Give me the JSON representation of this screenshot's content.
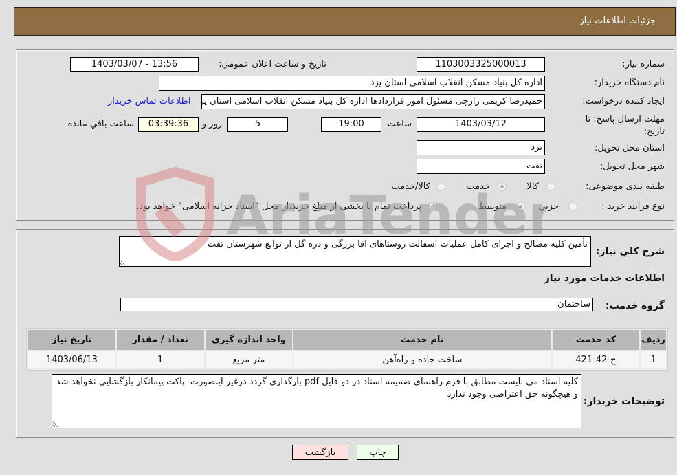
{
  "header": {
    "title": "جزئیات اطلاعات نیاز"
  },
  "details": {
    "need_number_label": "شماره نیاز:",
    "need_number": "1103003325000013",
    "announce_label": "تاریخ و ساعت اعلان عمومي:",
    "announce_value": "1403/03/07 - 13:56",
    "buyer_org_label": "نام دستگاه خریدار:",
    "buyer_org": "اداره کل بنیاد مسکن انقلاب اسلامی استان یزد",
    "requester_label": "ایجاد کننده درخواست:",
    "requester": "حمیدرضا کریمی زارچی مسئول امور قراردادها اداره کل بنیاد مسکن انقلاب اسلامی استان یزد",
    "buyer_contact_link": "اطلاعات تماس خریدار",
    "deadline_label": "مهلت ارسال پاسخ: تا تاریخ:",
    "deadline_date": "1403/03/12",
    "time_label": "ساعت",
    "deadline_time": "19:00",
    "days_value": "5",
    "days_label": "روز و",
    "remaining_time": "03:39:36",
    "remaining_label": "ساعت باقي مانده",
    "province_label": "استان محل تحویل:",
    "province": "یزد",
    "city_label": "شهر محل تحویل:",
    "city": "تفت",
    "category_label": "طبقه بندی موضوعی:",
    "category_options": [
      {
        "label": "کالا",
        "selected": false
      },
      {
        "label": "خدمت",
        "selected": true
      },
      {
        "label": "کالا/خدمت",
        "selected": false
      }
    ],
    "process_label": "نوع فرآیند خرید :",
    "process_options": [
      {
        "label": "جزيي",
        "selected": false
      },
      {
        "label": "متوسط",
        "selected": true
      }
    ],
    "treasury_checkbox_label": "پرداخت تمام یا بخشی از مبلغ خرید،از محل \"اسناد خزانه اسلامی\" خواهد بود.",
    "treasury_checked": true
  },
  "description": {
    "label": "شرح کلي نیاز:",
    "value": "تأمین کلیه مصالح و اجرای کامل عملیات آسفالت روستاهای آقا بزرگی و دره گل از توابع شهرستان تفت"
  },
  "services": {
    "section_title": "اطلاعات خدمات مورد نیاز",
    "group_label": "گروه خدمت:",
    "group_value": "ساختمان",
    "columns": [
      "ردیف",
      "کد خدمت",
      "نام خدمت",
      "واحد اندازه گیری",
      "تعداد / مقدار",
      "تاریخ نیاز"
    ],
    "rows": [
      [
        "1",
        "ج-42-421",
        "ساخت جاده و راه‌آهن",
        "متر مربع",
        "1",
        "1403/06/13"
      ]
    ]
  },
  "buyer_notes": {
    "label": "توضیحات خریدار:",
    "value": "کلیه اسناد می بایست مطابق با فرم راهنمای ضمیمه اسناد در دو فایل pdf بارگذاری گردد درغیر اینصورت  پاکت پیمانکار بازگشایی نخواهد شد و هیچگونه حق اعتراضی وجود ندارد"
  },
  "buttons": {
    "print": "چاپ",
    "back": "بازگشت"
  },
  "watermark": {
    "text": "AriaTender.neT"
  },
  "colors": {
    "header_bg": "#8e6e42",
    "link": "#1f22c9",
    "print_bg": "#edfde8",
    "back_bg": "#fde0e0",
    "remaining_bg": "#fdfde8"
  }
}
